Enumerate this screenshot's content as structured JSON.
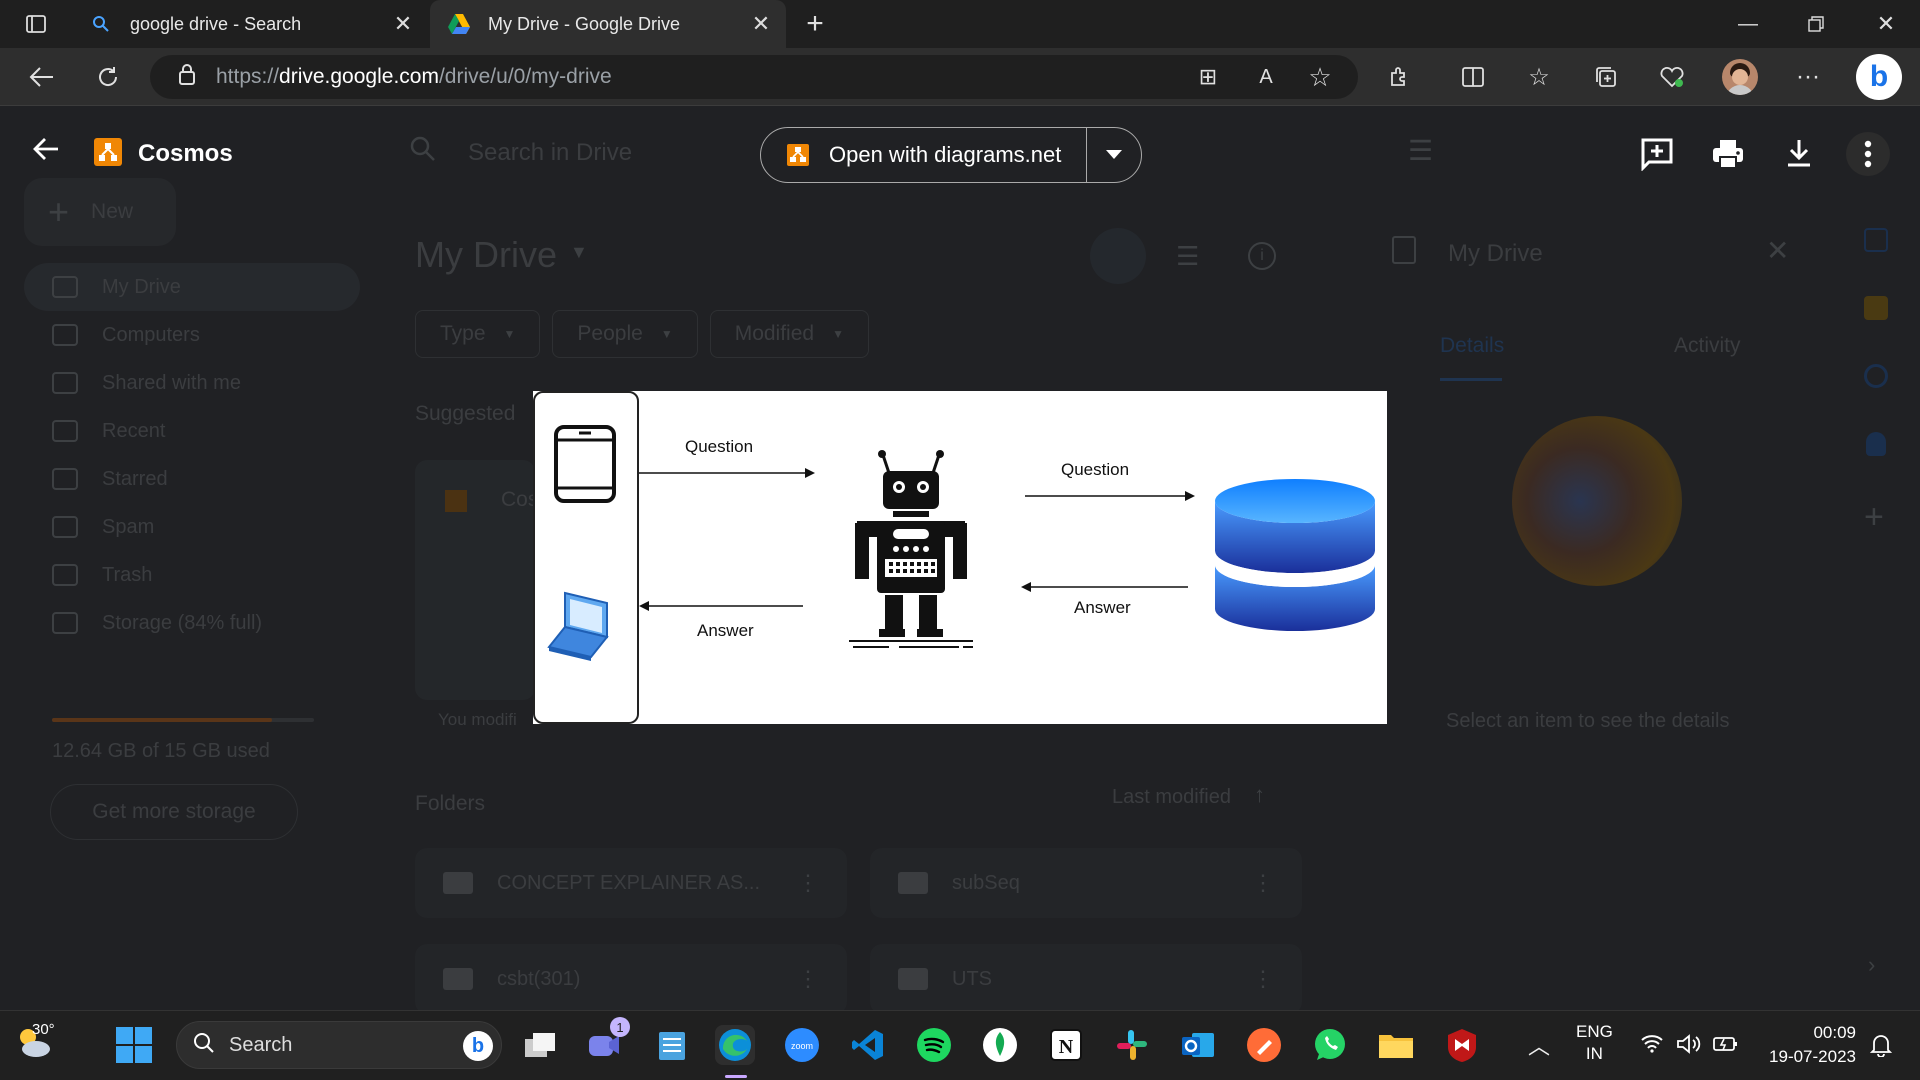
{
  "browser": {
    "tabs": [
      {
        "title": "google drive - Search",
        "active": false
      },
      {
        "title": "My Drive - Google Drive",
        "active": true
      }
    ],
    "url_prefix": "https://",
    "url_domain": "drive.google.com",
    "url_path": "/drive/u/0/my-drive"
  },
  "viewer": {
    "file_title": "Cosmos",
    "open_with_label": "Open with diagrams.net"
  },
  "drive": {
    "search_placeholder": "Search in Drive",
    "new_label": "New",
    "title": "My Drive",
    "filters": [
      "Type",
      "People",
      "Modified"
    ],
    "suggested_label": "Suggested",
    "suggested_file_initial": "Cos",
    "suggested_modified": "You modifi",
    "sidebar": [
      {
        "label": "My Drive",
        "icon": "drive-icon"
      },
      {
        "label": "Computers",
        "icon": "computer-icon"
      },
      {
        "label": "Shared with me",
        "icon": "people-icon"
      },
      {
        "label": "Recent",
        "icon": "clock-icon"
      },
      {
        "label": "Starred",
        "icon": "star-icon"
      },
      {
        "label": "Spam",
        "icon": "spam-icon"
      },
      {
        "label": "Trash",
        "icon": "trash-icon"
      },
      {
        "label": "Storage (84% full)",
        "icon": "cloud-icon"
      }
    ],
    "storage_used": "12.64 GB of 15 GB used",
    "storage_fraction": 0.84,
    "get_storage": "Get more storage",
    "folders_label": "Folders",
    "sort_label": "Last modified",
    "folders": [
      "CONCEPT EXPLAINER AS...",
      "subSeq",
      "csbt(301)",
      "UTS"
    ],
    "details_title": "My Drive",
    "details_tabs": [
      "Details",
      "Activity"
    ],
    "details_empty": "Select an item to see the details"
  },
  "diagram": {
    "q1": "Question",
    "a1": "Answer",
    "q2": "Question",
    "a2": "Answer"
  },
  "taskbar": {
    "weather_temp": "30°",
    "search_label": "Search",
    "lang_line1": "ENG",
    "lang_line2": "IN",
    "time": "00:09",
    "date": "19-07-2023",
    "chat_badge": "1"
  },
  "colors": {
    "accent_blue": "#1a73e8",
    "diagrams_orange": "#f08705",
    "chrome_dark": "#1f1f1f"
  }
}
